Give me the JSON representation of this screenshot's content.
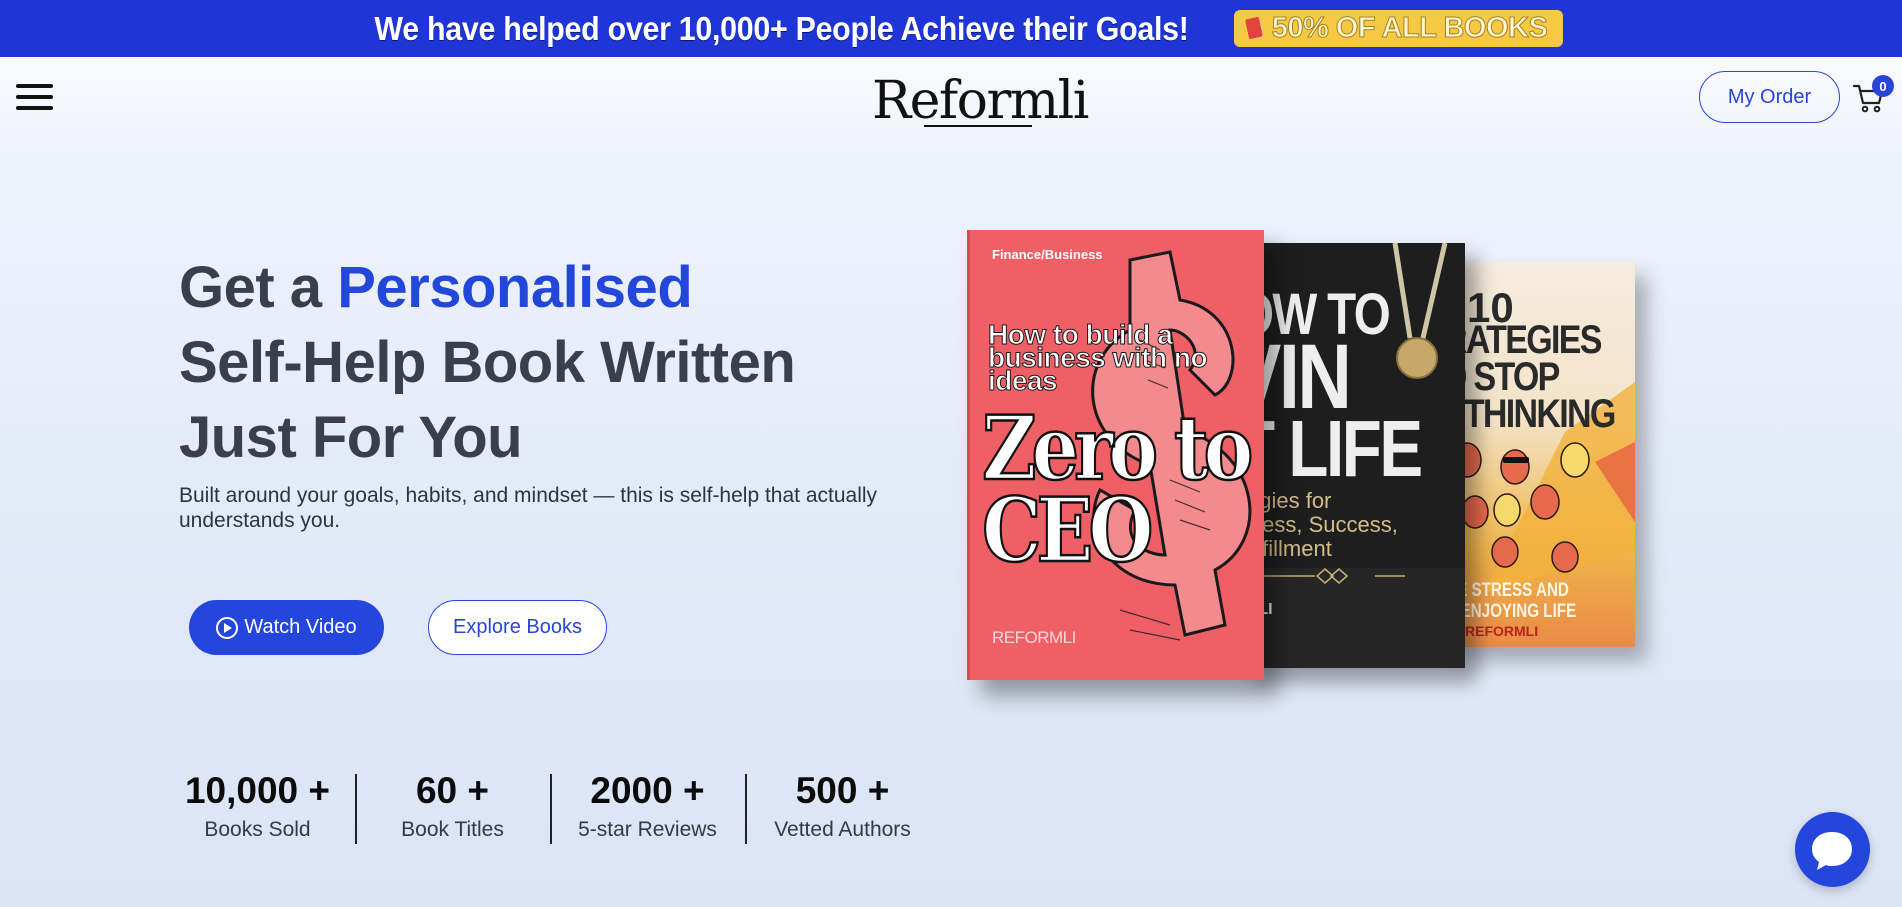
{
  "banner": {
    "text": "We have helped over 10,000+ People Achieve their Goals!",
    "badge": "50% OF ALL BOOKS"
  },
  "header": {
    "logo": "Reformli",
    "my_order": "My Order",
    "cart_count": "0"
  },
  "hero": {
    "title_prefix": "Get a",
    "title_accent": "Personalised",
    "title_line2": "Self-Help Book Written",
    "title_line3": "Just For You",
    "subtitle": "Built around your goals, habits, and mindset — this is self-help that actually understands you.",
    "watch_video": "Watch Video",
    "explore_books": "Explore Books"
  },
  "books": {
    "a": {
      "category": "Finance/Business",
      "subtitle_l1": "How to build a",
      "subtitle_l2": "business with no",
      "subtitle_l3": "ideas",
      "title_l1": "Zero to",
      "title_l2": "CEO",
      "publisher": "REFORMLI"
    },
    "b": {
      "title_l1": "OW TO",
      "title_l2": "VIN",
      "title_l3": "T LIFE",
      "sub_l1": "egies for",
      "sub_l2": "iness, Success,",
      "sub_l3": "ulfillment",
      "publisher": "MLI"
    },
    "c": {
      "title_l1": "10",
      "title_l2": "RATEGIES",
      "title_l3": "O STOP",
      "title_l4": "RTHINKING",
      "sub_l1": "VE STRESS AND",
      "sub_l2": "T ENJOYING LIFE",
      "publisher": "REFORMLI"
    }
  },
  "stats": [
    {
      "value": "10,000 +",
      "label": "Books Sold"
    },
    {
      "value": "60 +",
      "label": "Book Titles"
    },
    {
      "value": "2000 +",
      "label": "5-star Reviews"
    },
    {
      "value": "500 +",
      "label": "Vetted Authors"
    }
  ],
  "colors": {
    "brand": "#2446dd",
    "banner_bg": "#1f35d6",
    "badge_bg": "#f6c945"
  }
}
